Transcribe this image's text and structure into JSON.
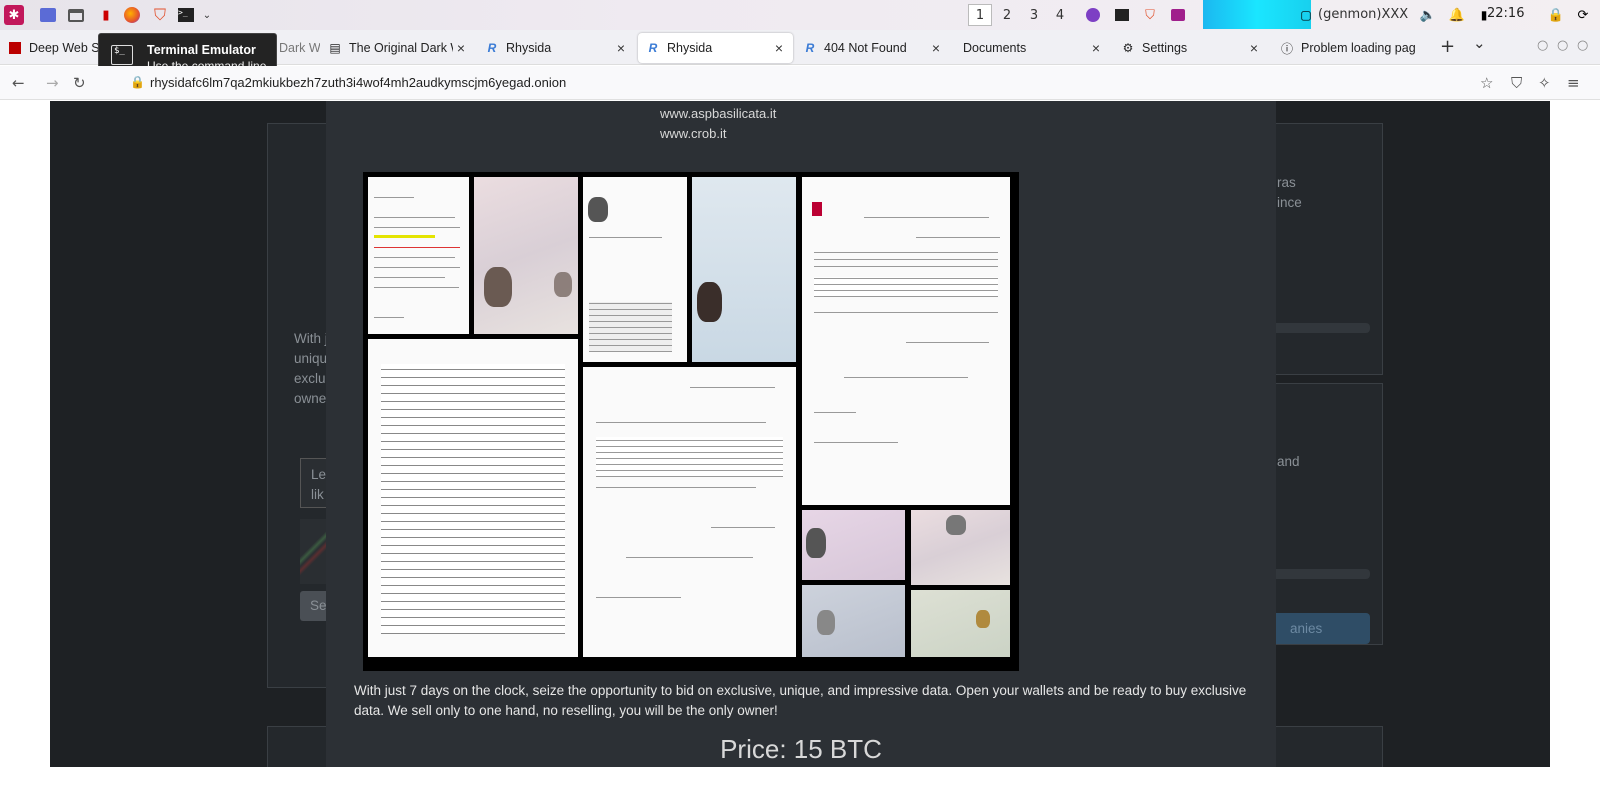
{
  "panel": {
    "workspaces": [
      "1",
      "2",
      "3",
      "4"
    ],
    "genmon": "(genmon)XXX",
    "clock": "22:16"
  },
  "tooltip": {
    "title": "Terminal Emulator",
    "subtitle": "Use the command line"
  },
  "tabs": [
    {
      "label": "Deep Web Se",
      "icon": "red-square-icon"
    },
    {
      "label": "Dark W",
      "icon": "page-icon"
    },
    {
      "label": "The Original Dark W",
      "icon": "page-icon"
    },
    {
      "label": "Rhysida",
      "icon": "rhysida-icon"
    },
    {
      "label": "Rhysida",
      "icon": "rhysida-icon",
      "active": true
    },
    {
      "label": "404 Not Found",
      "icon": "rhysida-icon"
    },
    {
      "label": "Documents",
      "icon": "none"
    },
    {
      "label": "Settings",
      "icon": "gear-icon"
    },
    {
      "label": "Problem loading pag",
      "icon": "info-icon"
    }
  ],
  "navbar": {
    "url": "rhysidafc6lm7qa2mkiukbezh7zuth3i4wof4mh2audkymscjm6yegad.onion"
  },
  "background": {
    "left_text": [
      "With j",
      "uniqu",
      "exclu",
      "owne"
    ],
    "input_text": [
      "Le",
      "lik"
    ],
    "button_text": "Se",
    "right_text_1": [
      "ras",
      "ince"
    ],
    "right_text_2": [
      "and"
    ],
    "right_button": "anies"
  },
  "modal": {
    "links": [
      "www.aspbasilicata.it",
      "www.crob.it"
    ],
    "description": "With just 7 days on the clock, seize the opportunity to bid on exclusive, unique, and impressive data. Open your wallets and be ready to buy exclusive data. We sell only to one hand, no reselling, you will be the only owner!",
    "price": "Price: 15 BTC"
  }
}
